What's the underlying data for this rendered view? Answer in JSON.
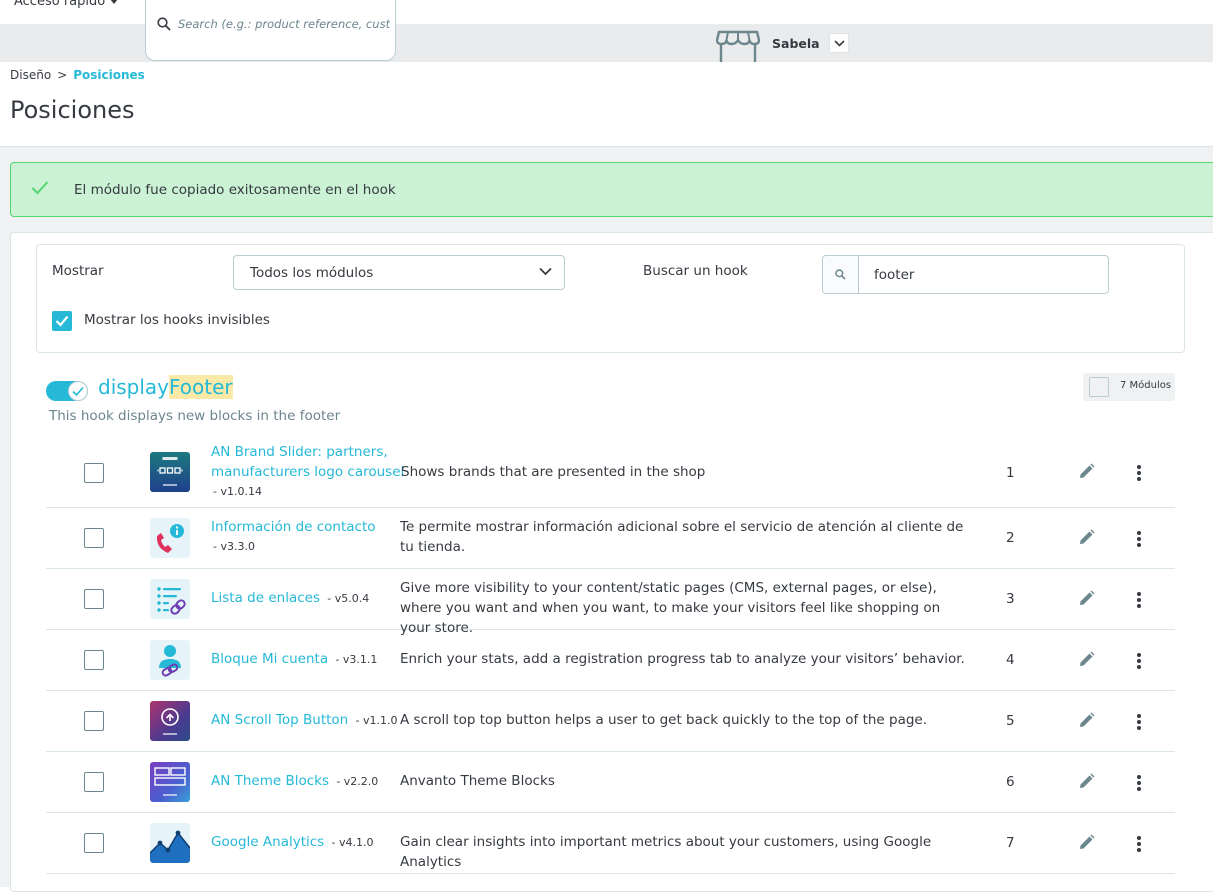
{
  "header": {
    "quick_access": "Acceso rápido",
    "search_placeholder": "Search (e.g.: product reference, custon",
    "shop_name": "Sabela"
  },
  "breadcrumb": {
    "parent": "Diseño",
    "separator": ">",
    "current": "Posiciones"
  },
  "page_title": "Posiciones",
  "alert": {
    "message": "El módulo fue copiado exitosamente en el hook"
  },
  "filters": {
    "show_label": "Mostrar",
    "show_value": "Todos los módulos",
    "search_label": "Buscar un hook",
    "search_value": "footer",
    "invisible_label": "Mostrar los hooks invisibles",
    "invisible_checked": true
  },
  "hook": {
    "name_prefix": "display",
    "name_highlight": "Footer",
    "description": "This hook displays new blocks in the footer",
    "module_count": "7 Módulos",
    "enabled": true
  },
  "modules": [
    {
      "name_line1": "AN Brand Slider: partners,",
      "name_line2": "manufacturers logo carousel",
      "version": "- v1.0.14",
      "description": "Shows brands that are presented in the shop",
      "position": "1",
      "icon": "brands-logo-icon"
    },
    {
      "name": "Información de contacto",
      "version": "- v3.3.0",
      "description": "Te permite mostrar información adicional sobre el servicio de atención al cliente de tu tienda.",
      "position": "2",
      "icon": "contact-info-icon"
    },
    {
      "name": "Lista de enlaces",
      "version": "- v5.0.4",
      "description": "Give more visibility to your content/static pages (CMS, external pages, or else), where you want and when you want, to make your visitors feel like shopping on your store.",
      "position": "3",
      "icon": "link-list-icon"
    },
    {
      "name": "Bloque Mi cuenta",
      "version": "- v3.1.1",
      "description": "Enrich your stats, add a registration progress tab to analyze your visitors’ behavior.",
      "position": "4",
      "icon": "my-account-icon"
    },
    {
      "name": "AN Scroll Top Button",
      "version": "- v1.1.0",
      "description": "A scroll top top button helps a user to get back quickly to the top of the page.",
      "position": "5",
      "icon": "scroll-top-icon"
    },
    {
      "name": "AN Theme Blocks",
      "version": "- v2.2.0",
      "description": "Anvanto Theme Blocks",
      "position": "6",
      "icon": "theme-blocks-icon"
    },
    {
      "name": "Google Analytics",
      "version": "- v4.1.0",
      "description": "Gain clear insights into important metrics about your customers, using Google Analytics",
      "position": "7",
      "icon": "analytics-chart-icon"
    }
  ],
  "colors": {
    "accent": "#25b9d7",
    "success_bg": "#cbf2d4",
    "success_border": "#53d572",
    "highlight": "#fbe9a8"
  }
}
